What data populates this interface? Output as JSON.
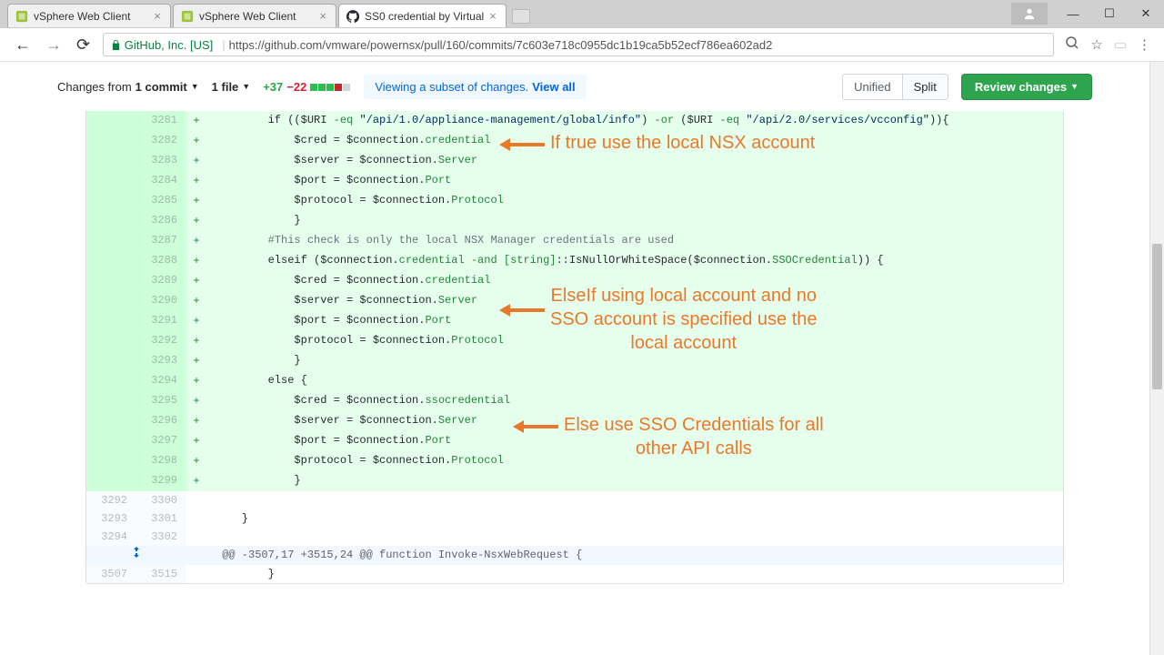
{
  "browser": {
    "tabs": [
      {
        "title": "vSphere Web Client",
        "favicon": "vsphere",
        "active": false
      },
      {
        "title": "vSphere Web Client",
        "favicon": "vsphere",
        "active": false
      },
      {
        "title": "SS0 credential by Virtual",
        "favicon": "github",
        "active": true
      }
    ],
    "url_prefix": "GitHub, Inc. [US]",
    "url": "https://github.com/vmware/powernsx/pull/160/commits/7c603e718c0955dc1b19ca5b52ecf786ea602ad2"
  },
  "toolbar": {
    "changes_from": "Changes from",
    "changes_from_val": "1 commit",
    "file_count": "1 file",
    "add": "+37",
    "del": "−22",
    "subset_text": "Viewing a subset of changes.",
    "view_all": "View all",
    "unified": "Unified",
    "split": "Split",
    "review": "Review changes"
  },
  "hunk": "@@ -3507,17 +3515,24 @@ function Invoke-NsxWebRequest {",
  "lines": [
    {
      "old": "",
      "new": "3281",
      "m": "+",
      "html": "        if (($URI <span class='pl-e'>-eq</span> <span class='pl-c1'>\"/api/1.0/appliance-management/global/info\"</span>) <span class='pl-e'>-or</span> ($URI <span class='pl-e'>-eq</span> <span class='pl-c1'>\"/api/2.0/services/vcconfig\"</span>)){"
    },
    {
      "old": "",
      "new": "3282",
      "m": "+",
      "html": "            $cred = $connection.<span class='pl-e'>credential</span>"
    },
    {
      "old": "",
      "new": "3283",
      "m": "+",
      "html": "            $server = $connection.<span class='pl-e'>Server</span>"
    },
    {
      "old": "",
      "new": "3284",
      "m": "+",
      "html": "            $port = $connection.<span class='pl-e'>Port</span>"
    },
    {
      "old": "",
      "new": "3285",
      "m": "+",
      "html": "            $protocol = $connection.<span class='pl-e'>Protocol</span>"
    },
    {
      "old": "",
      "new": "3286",
      "m": "+",
      "html": "            }"
    },
    {
      "old": "",
      "new": "3287",
      "m": "+",
      "html": "        <span class='pl-cmt'>#This check is only the local NSX Manager credentials are used</span>"
    },
    {
      "old": "",
      "new": "3288",
      "m": "+",
      "html": "        elseif ($connection.<span class='pl-e'>credential</span> <span class='pl-e'>-and</span> <span class='pl-e'>[string]</span>::IsNullOrWhiteSpace($connection.<span class='pl-e'>SSOCredential</span>)) {"
    },
    {
      "old": "",
      "new": "3289",
      "m": "+",
      "html": "            $cred = $connection.<span class='pl-e'>credential</span>"
    },
    {
      "old": "",
      "new": "3290",
      "m": "+",
      "html": "            $server = $connection.<span class='pl-e'>Server</span>"
    },
    {
      "old": "",
      "new": "3291",
      "m": "+",
      "html": "            $port = $connection.<span class='pl-e'>Port</span>"
    },
    {
      "old": "",
      "new": "3292",
      "m": "+",
      "html": "            $protocol = $connection.<span class='pl-e'>Protocol</span>"
    },
    {
      "old": "",
      "new": "3293",
      "m": "+",
      "html": "            }"
    },
    {
      "old": "",
      "new": "3294",
      "m": "+",
      "html": "        else {"
    },
    {
      "old": "",
      "new": "3295",
      "m": "+",
      "html": "            $cred = $connection.<span class='pl-e'>ssocredential</span>"
    },
    {
      "old": "",
      "new": "3296",
      "m": "+",
      "html": "            $server = $connection.<span class='pl-e'>Server</span>"
    },
    {
      "old": "",
      "new": "3297",
      "m": "+",
      "html": "            $port = $connection.<span class='pl-e'>Port</span>"
    },
    {
      "old": "",
      "new": "3298",
      "m": "+",
      "html": "            $protocol = $connection.<span class='pl-e'>Protocol</span>"
    },
    {
      "old": "",
      "new": "3299",
      "m": "+",
      "html": "            }"
    },
    {
      "old": "3292",
      "new": "3300",
      "m": "",
      "html": "",
      "ctx": true
    },
    {
      "old": "3293",
      "new": "3301",
      "m": "",
      "html": "    }",
      "ctx": true
    },
    {
      "old": "3294",
      "new": "3302",
      "m": "",
      "html": "",
      "ctx": true
    }
  ],
  "post_hunk": {
    "old": "3507",
    "new": "3515",
    "html": "        }"
  },
  "annotations": {
    "a1": "If true use the local NSX account",
    "a2": "ElseIf using local account and no\nSSO account is specified use the\nlocal account",
    "a3": "Else use SSO Credentials for all\nother API calls"
  }
}
